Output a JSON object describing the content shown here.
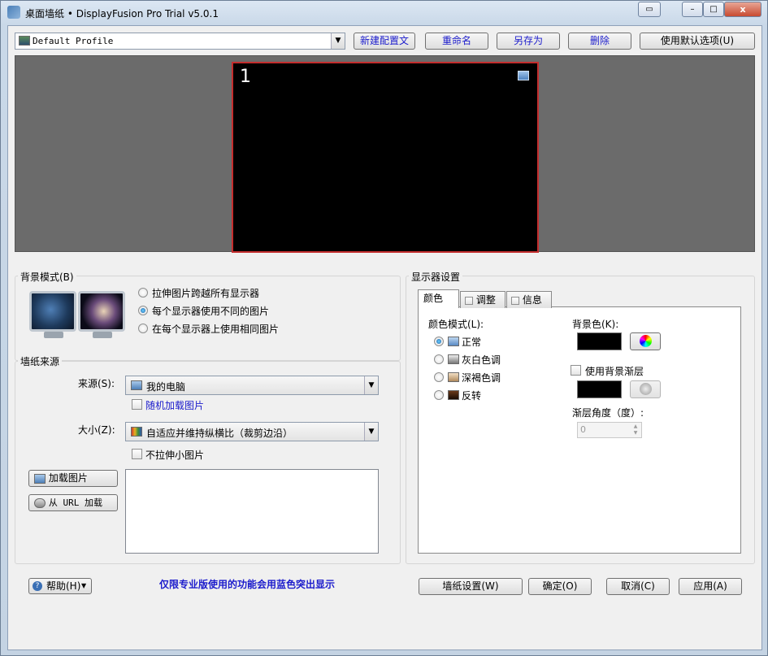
{
  "window": {
    "title": "桌面墙纸 • DisplayFusion Pro Trial v5.0.1",
    "close_label": "x"
  },
  "profile": {
    "selected": "Default Profile",
    "new_label": "新建配置文",
    "rename_label": "重命名",
    "save_as_label": "另存为",
    "delete_label": "删除",
    "use_defaults_label": "使用默认选项(U)"
  },
  "preview": {
    "monitor_number": "1"
  },
  "background_mode": {
    "title": "背景模式(B)",
    "options": [
      "拉伸图片跨越所有显示器",
      "每个显示器使用不同的图片",
      "在每个显示器上使用相同图片"
    ],
    "selected_index": 1
  },
  "wallpaper_source": {
    "title": "墙纸来源",
    "source_label": "来源(S):",
    "source_value": "我的电脑",
    "random_label": "随机加载图片",
    "size_label": "大小(Z):",
    "size_value": "自适应并维持纵横比（裁剪边沿）",
    "no_stretch_label": "不拉伸小图片",
    "load_image_label": "加载图片",
    "load_url_label": "从 URL 加载"
  },
  "monitor_settings": {
    "title": "显示器设置",
    "tabs": [
      "颜色",
      "调整",
      "信息"
    ],
    "color_mode_label": "颜色模式(L):",
    "color_modes": [
      "正常",
      "灰白色调",
      "深褐色调",
      "反转"
    ],
    "selected_mode_index": 0,
    "bg_color_label": "背景色(K):",
    "use_gradient_label": "使用背景渐层",
    "gradient_angle_label": "渐层角度（度）:",
    "gradient_angle_value": "0"
  },
  "footer": {
    "help_label": "帮助(H)",
    "pro_note": "仅限专业版使用的功能会用蓝色突出显示",
    "wallpaper_settings_label": "墙纸设置(W)",
    "ok_label": "确定(O)",
    "cancel_label": "取消(C)",
    "apply_label": "应用(A)"
  }
}
